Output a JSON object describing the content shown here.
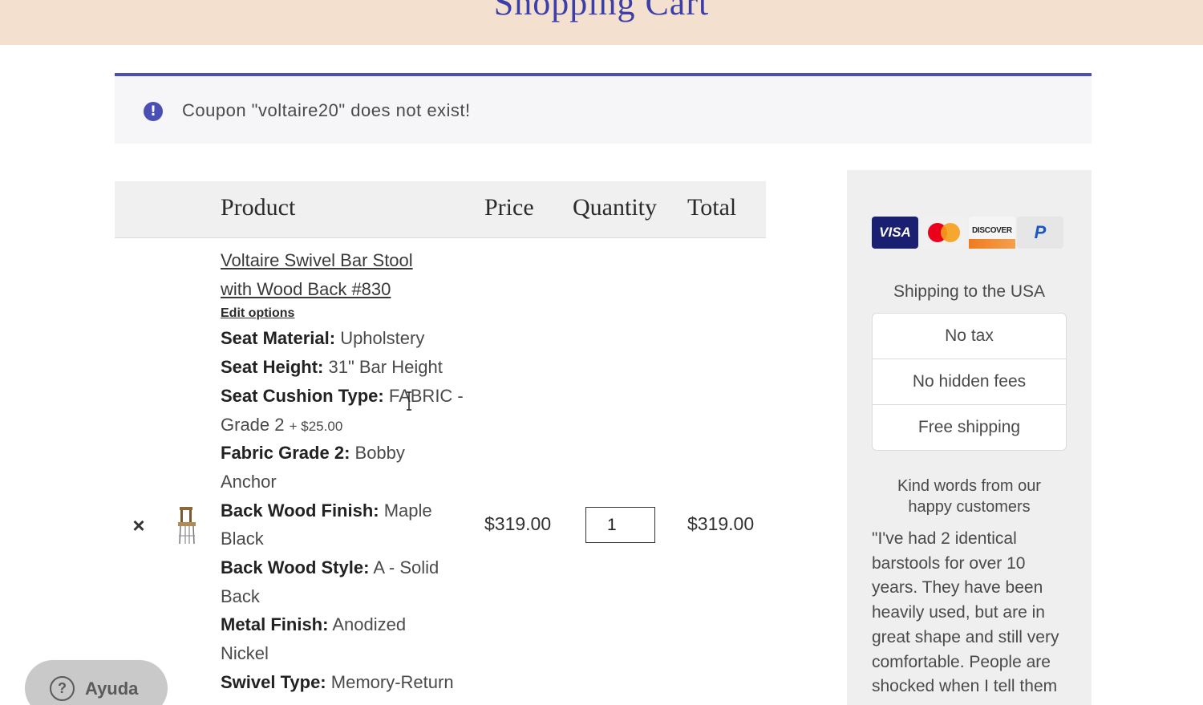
{
  "header": {
    "title": "Shopping Cart"
  },
  "notice": {
    "message": "Coupon \"voltaire20\" does not exist!",
    "icon": "exclamation-circle-icon"
  },
  "table": {
    "headers": {
      "product": "Product",
      "price": "Price",
      "quantity": "Quantity",
      "total": "Total"
    }
  },
  "item": {
    "name_line1": "Voltaire Swivel Bar Stool",
    "name_line2": "with Wood Back #830",
    "edit_label": "Edit options",
    "attributes": [
      {
        "label": "Seat Material:",
        "value": "Upholstery"
      },
      {
        "label": "Seat Height:",
        "value": "31\" Bar Height"
      },
      {
        "label": "Seat Cushion Type:",
        "value": "FABRIC -"
      },
      {
        "value_cont": "Grade 2",
        "addon": "+ $25.00"
      },
      {
        "label": "Fabric Grade 2:",
        "value": "Bobby"
      },
      {
        "value_cont": "Anchor"
      },
      {
        "label": "Back Wood Finish:",
        "value": "Maple"
      },
      {
        "value_cont": "Black"
      },
      {
        "label": "Back Wood Style:",
        "value": "A - Solid"
      },
      {
        "value_cont": "Back"
      },
      {
        "label": "Metal Finish:",
        "value": "Anodized"
      },
      {
        "value_cont": "Nickel"
      },
      {
        "label": "Swivel Type:",
        "value": "Memory-Return"
      }
    ],
    "remove_symbol": "×",
    "price": "$319.00",
    "quantity": "1",
    "total": "$319.00"
  },
  "sidebar": {
    "payment_cards": [
      "VISA",
      "Mastercard",
      "DISCOVER",
      "P"
    ],
    "shipping_title": "Shipping to the USA",
    "benefits": [
      "No tax",
      "No hidden fees",
      "Free shipping"
    ],
    "kind_words_line1": "Kind words from our",
    "kind_words_line2": "happy customers",
    "quote": "\"I've had 2 identical barstools for over 10 years. They have been heavily used, but are in great shape and still very comfortable. People are shocked when I tell them"
  },
  "help": {
    "label": "Ayuda",
    "icon": "question-icon"
  },
  "colors": {
    "accent": "#4b4fb4",
    "header_bg": "#f4e0cf",
    "title": "#3c3fa8"
  }
}
